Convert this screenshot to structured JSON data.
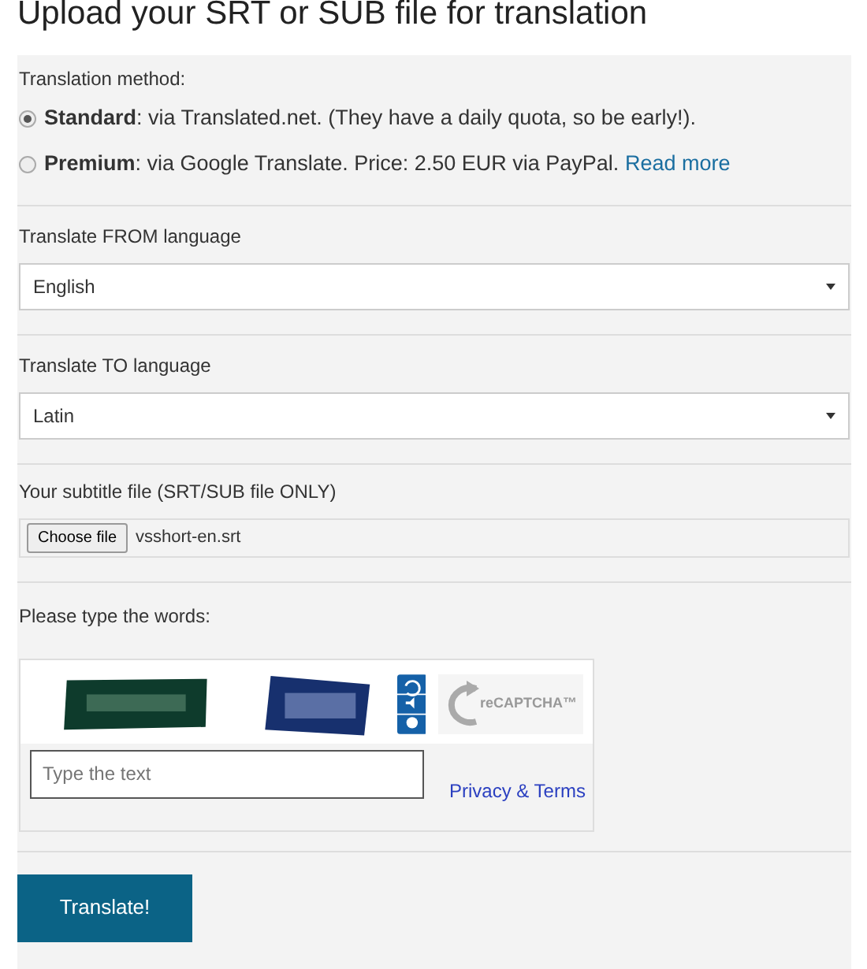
{
  "title": "Upload your SRT or SUB file for translation",
  "method": {
    "label": "Translation method:",
    "options": [
      {
        "text": "**Standard**: via Translated.net. (They have a daily quota, so be early!).",
        "selected": true
      },
      {
        "text": "**Premium**: via Google Translate. Price: 2.50 EUR via PayPal.",
        "link": "Read more",
        "selected": false
      }
    ]
  },
  "selects": [
    {
      "label": "Translate FROM language",
      "value": "English"
    },
    {
      "label": "Translate TO language",
      "value": "Latin"
    }
  ],
  "file": {
    "label": "Your subtitle file (SRT/SUB file ONLY)",
    "button": "Choose file",
    "filename": "vsshort-en.srt"
  },
  "captcha": {
    "label": "Please type the words:",
    "placeholder": "Type the text",
    "logo": "reCAPTCHA™",
    "link": "Privacy & Terms"
  },
  "submit": "Translate!"
}
